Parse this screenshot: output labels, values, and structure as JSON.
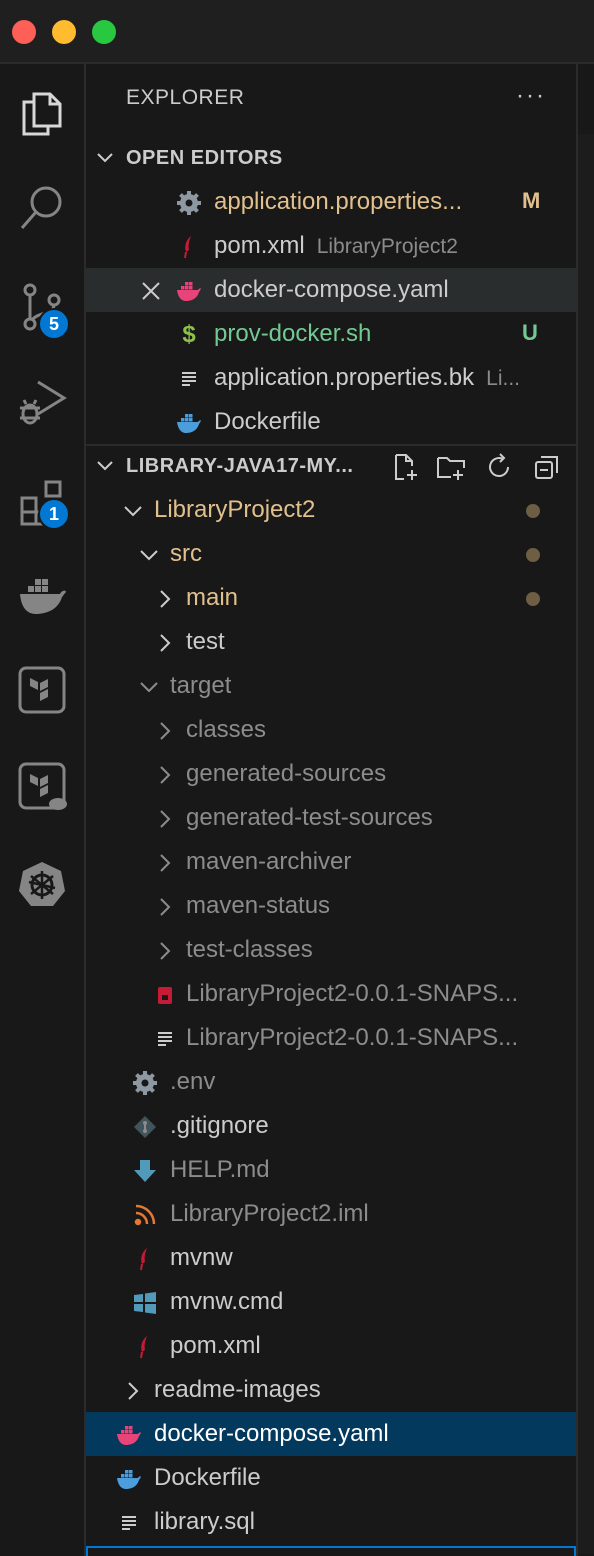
{
  "explorer": {
    "title": "EXPLORER",
    "more": "···"
  },
  "activity_bar": {
    "items": [
      {
        "name": "explorer-icon"
      },
      {
        "name": "search-icon"
      },
      {
        "name": "source-control-icon",
        "badge": "5"
      },
      {
        "name": "run-debug-icon"
      },
      {
        "name": "extensions-icon",
        "badge": "1"
      },
      {
        "name": "docker-icon"
      },
      {
        "name": "terraform-icon"
      },
      {
        "name": "terraform-cloud-icon"
      },
      {
        "name": "kubernetes-icon"
      }
    ]
  },
  "open_editors": {
    "title": "OPEN EDITORS",
    "items": [
      {
        "label": "application.properties...",
        "status": "M",
        "icon": "gear-icon"
      },
      {
        "label": "pom.xml",
        "desc": "LibraryProject2",
        "icon": "maven-icon"
      },
      {
        "label": "docker-compose.yaml",
        "icon": "docker-icon"
      },
      {
        "label": "prov-docker.sh",
        "status": "U",
        "icon": "shell-icon"
      },
      {
        "label": "application.properties.bk",
        "desc": "Li...",
        "icon": "text-file-icon"
      },
      {
        "label": "Dockerfile",
        "icon": "docker-icon"
      }
    ]
  },
  "folder": {
    "title": "LIBRARY-JAVA17-MY...",
    "items": [
      {
        "label": "LibraryProject2"
      },
      {
        "label": "src"
      },
      {
        "label": "main"
      },
      {
        "label": "test"
      },
      {
        "label": "target"
      },
      {
        "label": "classes"
      },
      {
        "label": "generated-sources"
      },
      {
        "label": "generated-test-sources"
      },
      {
        "label": "maven-archiver"
      },
      {
        "label": "maven-status"
      },
      {
        "label": "test-classes"
      },
      {
        "label": "LibraryProject2-0.0.1-SNAPS..."
      },
      {
        "label": "LibraryProject2-0.0.1-SNAPS..."
      },
      {
        "label": ".env"
      },
      {
        "label": ".gitignore"
      },
      {
        "label": "HELP.md"
      },
      {
        "label": "LibraryProject2.iml"
      },
      {
        "label": "mvnw"
      },
      {
        "label": "mvnw.cmd"
      },
      {
        "label": "pom.xml"
      },
      {
        "label": "readme-images"
      },
      {
        "label": "docker-compose.yaml"
      },
      {
        "label": "Dockerfile"
      },
      {
        "label": "library.sql"
      }
    ]
  },
  "colors": {
    "accent": "#0078d4",
    "modified": "#e2c08d",
    "untracked": "#73c991",
    "selection": "#04395e"
  }
}
